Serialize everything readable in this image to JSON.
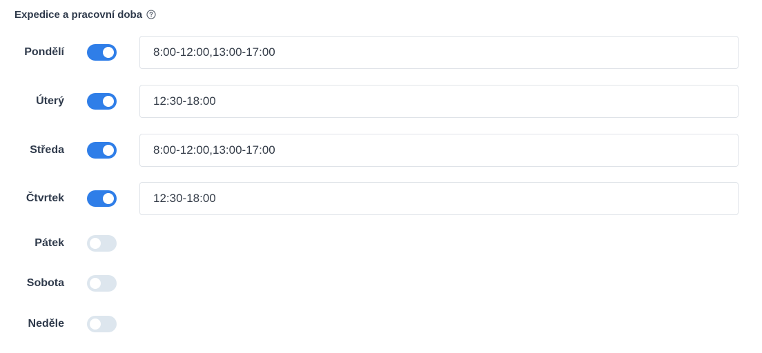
{
  "header": {
    "title": "Expedice a pracovní doba",
    "help_icon": "help-circle-icon"
  },
  "colors": {
    "toggle_on": "#2f7ee8",
    "toggle_off": "#dde6ee",
    "label": "#2f3a4b"
  },
  "days": [
    {
      "label": "Pondělí",
      "enabled": true,
      "hours": "8:00-12:00,13:00-17:00"
    },
    {
      "label": "Úterý",
      "enabled": true,
      "hours": "12:30-18:00"
    },
    {
      "label": "Středa",
      "enabled": true,
      "hours": "8:00-12:00,13:00-17:00"
    },
    {
      "label": "Čtvrtek",
      "enabled": true,
      "hours": "12:30-18:00"
    },
    {
      "label": "Pátek",
      "enabled": false,
      "hours": ""
    },
    {
      "label": "Sobota",
      "enabled": false,
      "hours": ""
    },
    {
      "label": "Neděle",
      "enabled": false,
      "hours": ""
    }
  ]
}
